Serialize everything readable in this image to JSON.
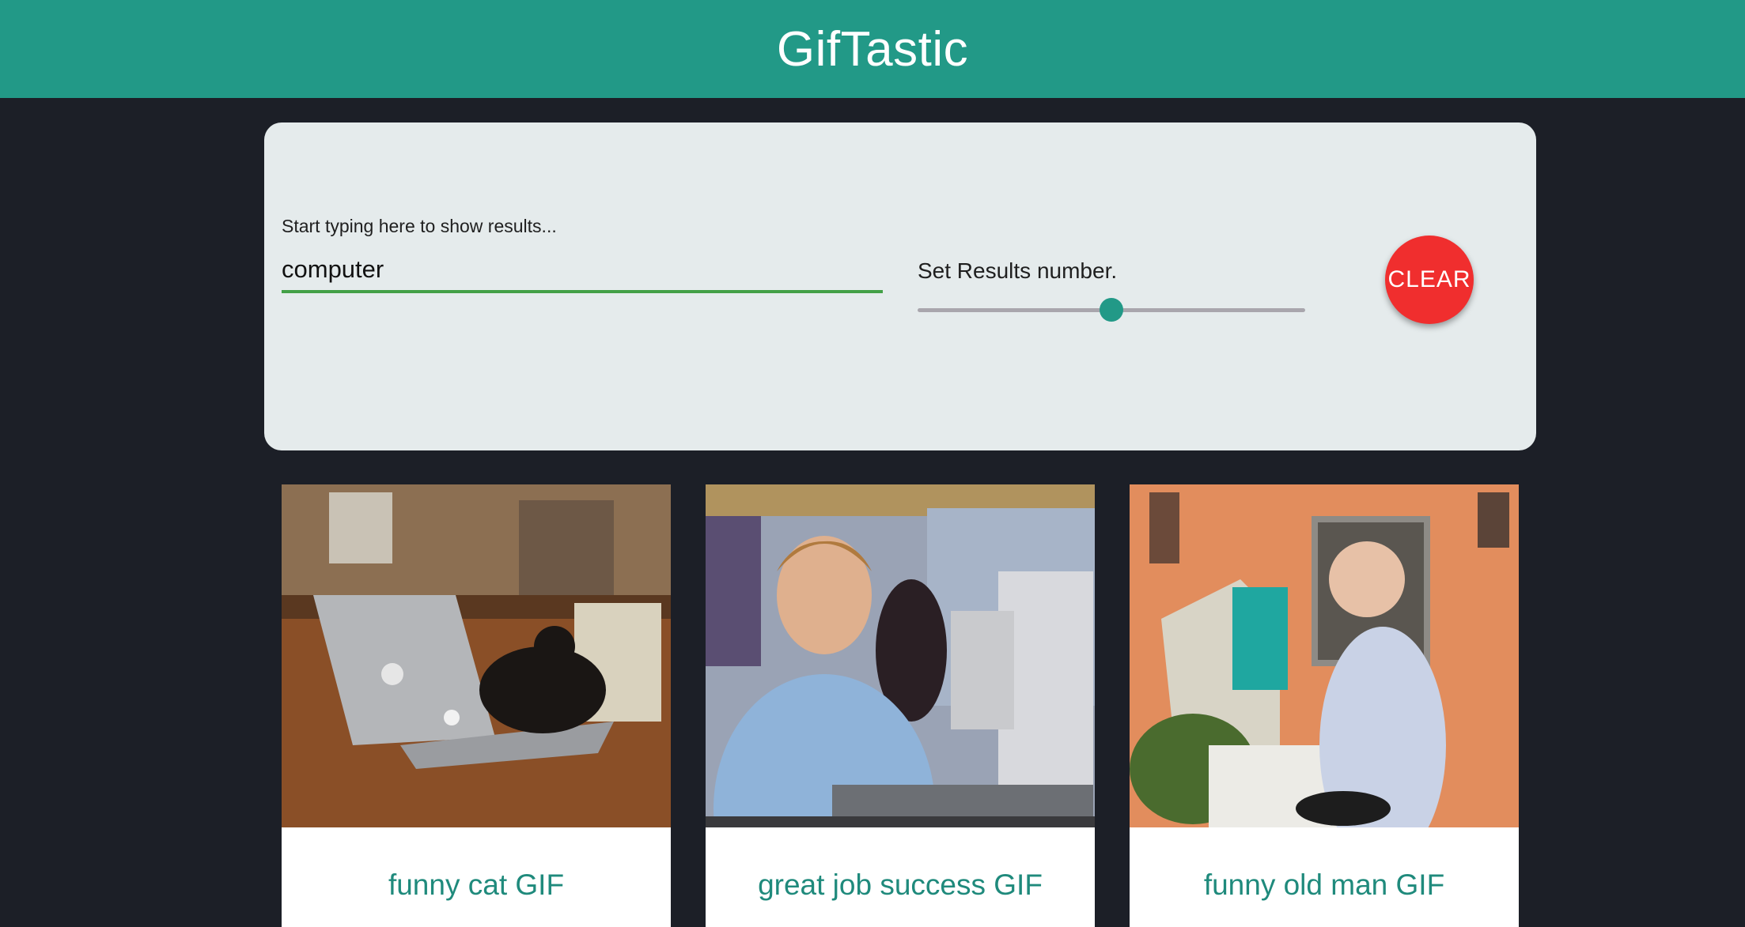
{
  "header": {
    "title": "GifTastic"
  },
  "search": {
    "label": "Start typing here to show results...",
    "value": "computer"
  },
  "results_slider": {
    "label": "Set Results number.",
    "value_fraction": 0.5
  },
  "clear_button": {
    "label": "CLEAR"
  },
  "colors": {
    "accent": "#229987",
    "clear": "#f02e2e",
    "input_underline": "#43a047",
    "background": "#1c1f27",
    "panel": "#e5ebec"
  },
  "gifs": [
    {
      "title": "funny cat GIF"
    },
    {
      "title": "great job success GIF"
    },
    {
      "title": "funny old man GIF"
    }
  ]
}
